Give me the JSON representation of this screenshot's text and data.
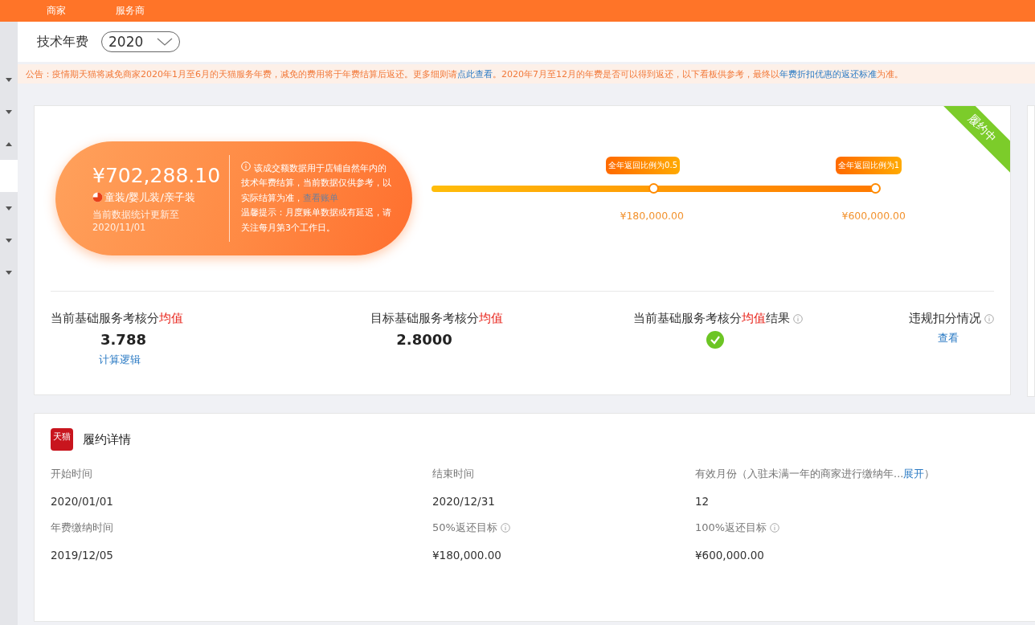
{
  "top_nav": [
    {
      "label": "商家",
      "selected": false
    },
    {
      "label": "服务商",
      "selected": false
    }
  ],
  "sidebar": {
    "items": [
      {
        "kind": "caret",
        "expanded": false
      },
      {
        "kind": "caret",
        "expanded": false
      },
      {
        "kind": "caret",
        "expanded": true
      },
      {
        "kind": "highlight"
      },
      {
        "kind": "caret",
        "expanded": false
      },
      {
        "kind": "caret",
        "expanded": false
      },
      {
        "kind": "caret",
        "expanded": false
      }
    ]
  },
  "header": {
    "title": "技术年费",
    "year_select": {
      "value": "2020"
    }
  },
  "notice": [
    {
      "kind": "text",
      "text": "公告：疫情期天猫将减免商家2020年1月至6月的天猫服务年费，减免的费用将于年费结算后返还。更多细则请"
    },
    {
      "kind": "link",
      "text": "点此查看"
    },
    {
      "kind": "text",
      "text": "。2020年7月至12月的年费是否可以得到返还，以下看板供参考，最终以"
    },
    {
      "kind": "link",
      "text": "年费折扣优惠的返还标准"
    },
    {
      "kind": "text",
      "text": "为准。"
    }
  ],
  "summary": {
    "status_ribbon": "履约中",
    "amount": "¥702,288.10",
    "category": "童装/婴儿装/亲子装",
    "updated": "当前数据统计更新至 2020/11/01",
    "info": {
      "text": "该成交额数据用于店铺自然年内的技术年费结算，当前数据仅供参考，以实际结算为准，",
      "link": "查看账单",
      "tip": "温馨提示：月度账单数据或有延迟，请关注每月第3个工作日。"
    },
    "progress": {
      "level": 1,
      "milestones": [
        {
          "tag": "全年返回比例为0.5",
          "amount": "¥180,000.00",
          "reached": true
        },
        {
          "tag": "全年返回比例为1",
          "amount": "¥600,000.00",
          "reached": true
        }
      ]
    },
    "metrics": [
      {
        "kind": "value",
        "label": "当前基础服务考核分",
        "highlight": "均值",
        "info": false,
        "value": "3.788",
        "link": "计算逻辑"
      },
      {
        "kind": "value",
        "label": "目标基础服务考核分",
        "highlight": "均值",
        "info": false,
        "value": "2.8000"
      },
      {
        "kind": "check",
        "label": "当前基础服务考核分",
        "highlight": "均值",
        "suffix": "结果",
        "info": true,
        "passed": true
      },
      {
        "kind": "link",
        "label": "违规扣分情况",
        "info": true,
        "link": "查看"
      }
    ]
  },
  "details": {
    "title": "履约详情",
    "logo": "天猫",
    "fields": [
      {
        "label": "开始时间",
        "value": "2020/01/01",
        "info": false
      },
      {
        "label": "结束时间",
        "value": "2020/12/31",
        "info": false
      },
      {
        "label": "有效月份（入驻未满一年的商家进行缴纳年...",
        "link": "展开",
        "label_end": "）",
        "value": "12",
        "info": false
      },
      {
        "label": "年费缴纳时间",
        "value": "2019/12/05",
        "info": false
      },
      {
        "label": "50%返还目标",
        "value": "¥180,000.00",
        "info": true
      },
      {
        "label": "100%返还目标",
        "value": "¥600,000.00",
        "info": true
      }
    ]
  }
}
